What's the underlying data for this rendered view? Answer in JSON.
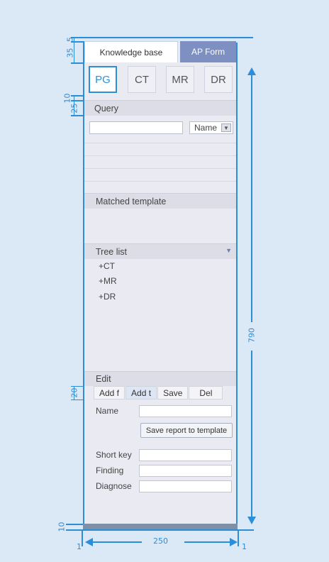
{
  "tabs": {
    "knowledge_base": "Knowledge base",
    "ap_form": "AP Form"
  },
  "modalities": [
    "PG",
    "CT",
    "MR",
    "DR"
  ],
  "query": {
    "header": "Query",
    "input_value": "",
    "select_value": "Name"
  },
  "matched_template": {
    "header": "Matched template"
  },
  "tree": {
    "header": "Tree list",
    "items": [
      "+CT",
      "+MR",
      "+DR"
    ]
  },
  "edit": {
    "header": "Edit",
    "tabs": [
      "Add f",
      "Add t",
      "Save",
      "Del"
    ],
    "name_label": "Name",
    "save_template_button": "Save report to template",
    "short_key_label": "Short key",
    "finding_label": "Finding",
    "diagnose_label": "Diagnose"
  },
  "dimensions": {
    "top_gap": "5",
    "tab_height": "35",
    "gap_10_top": "10",
    "header_25": "25",
    "total_height": "790",
    "edit_tab_20": "20",
    "bottom_10": "10",
    "width": "250",
    "left_border": "1",
    "right_border": "1"
  },
  "colors": {
    "accent": "#2d8ed8",
    "tab_active_bg": "#7e8fc1",
    "background": "#dbe8f6"
  }
}
